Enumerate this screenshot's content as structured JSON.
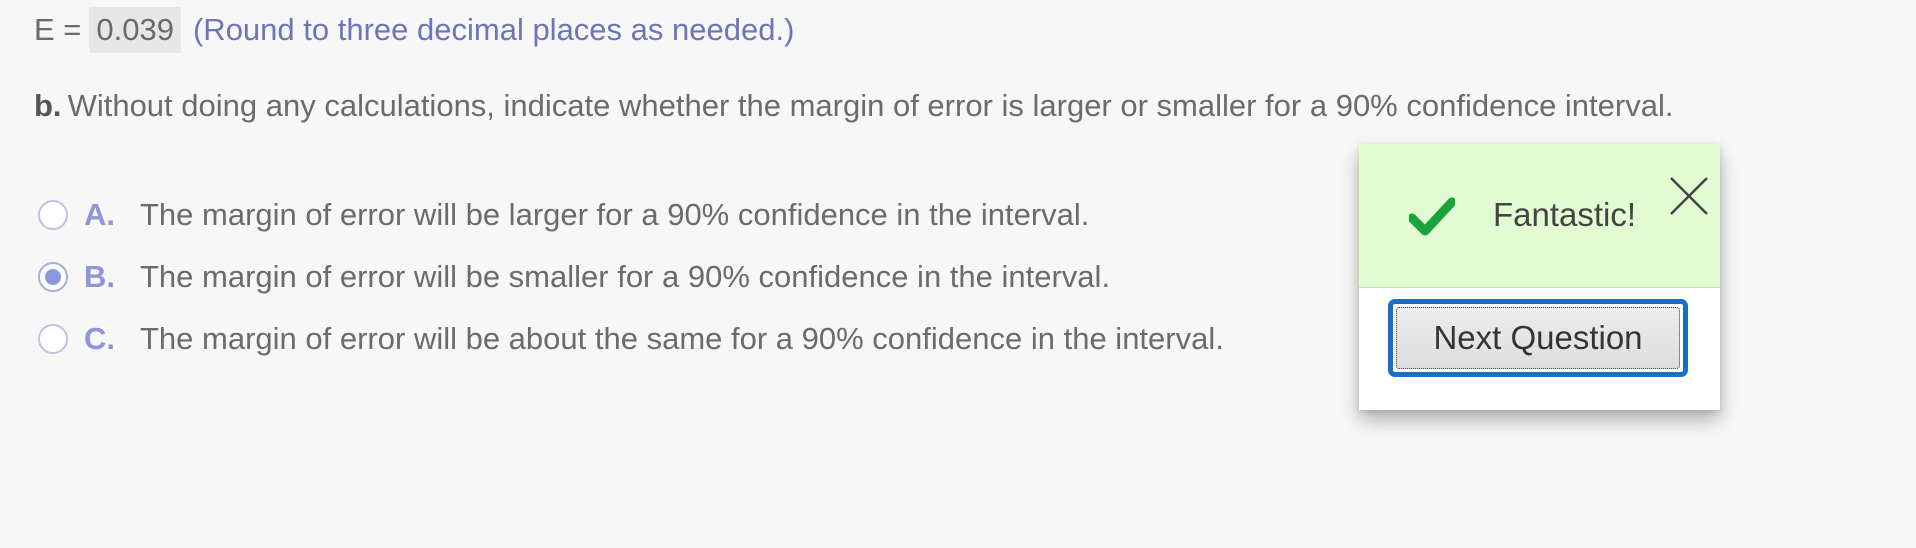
{
  "part_a": {
    "label": "E =",
    "value": "0.039",
    "hint": "(Round to three decimal places as needed.)"
  },
  "part_b": {
    "part_label": "b.",
    "prompt": "Without doing any calculations, indicate whether the margin of error is larger or smaller for a 90% confidence interval."
  },
  "options": [
    {
      "letter": "A.",
      "text": "The margin of error will be larger for a 90% confidence in the interval.",
      "selected": false
    },
    {
      "letter": "B.",
      "text": "The margin of error will be smaller for a 90% confidence in the interval.",
      "selected": true
    },
    {
      "letter": "C.",
      "text": "The margin of error will be about the same for a 90% confidence in the interval.",
      "selected": false
    }
  ],
  "feedback": {
    "message": "Fantastic!",
    "next_button_label": "Next Question",
    "icon": "checkmark-icon",
    "close_icon": "close-icon",
    "colors": {
      "header_bg": "#e1fbd3",
      "check": "#1aa33a",
      "button_focus": "#1a6fc4"
    }
  },
  "colors": {
    "accent_text": "#6f73b8",
    "option_letter": "#8d96d8"
  }
}
